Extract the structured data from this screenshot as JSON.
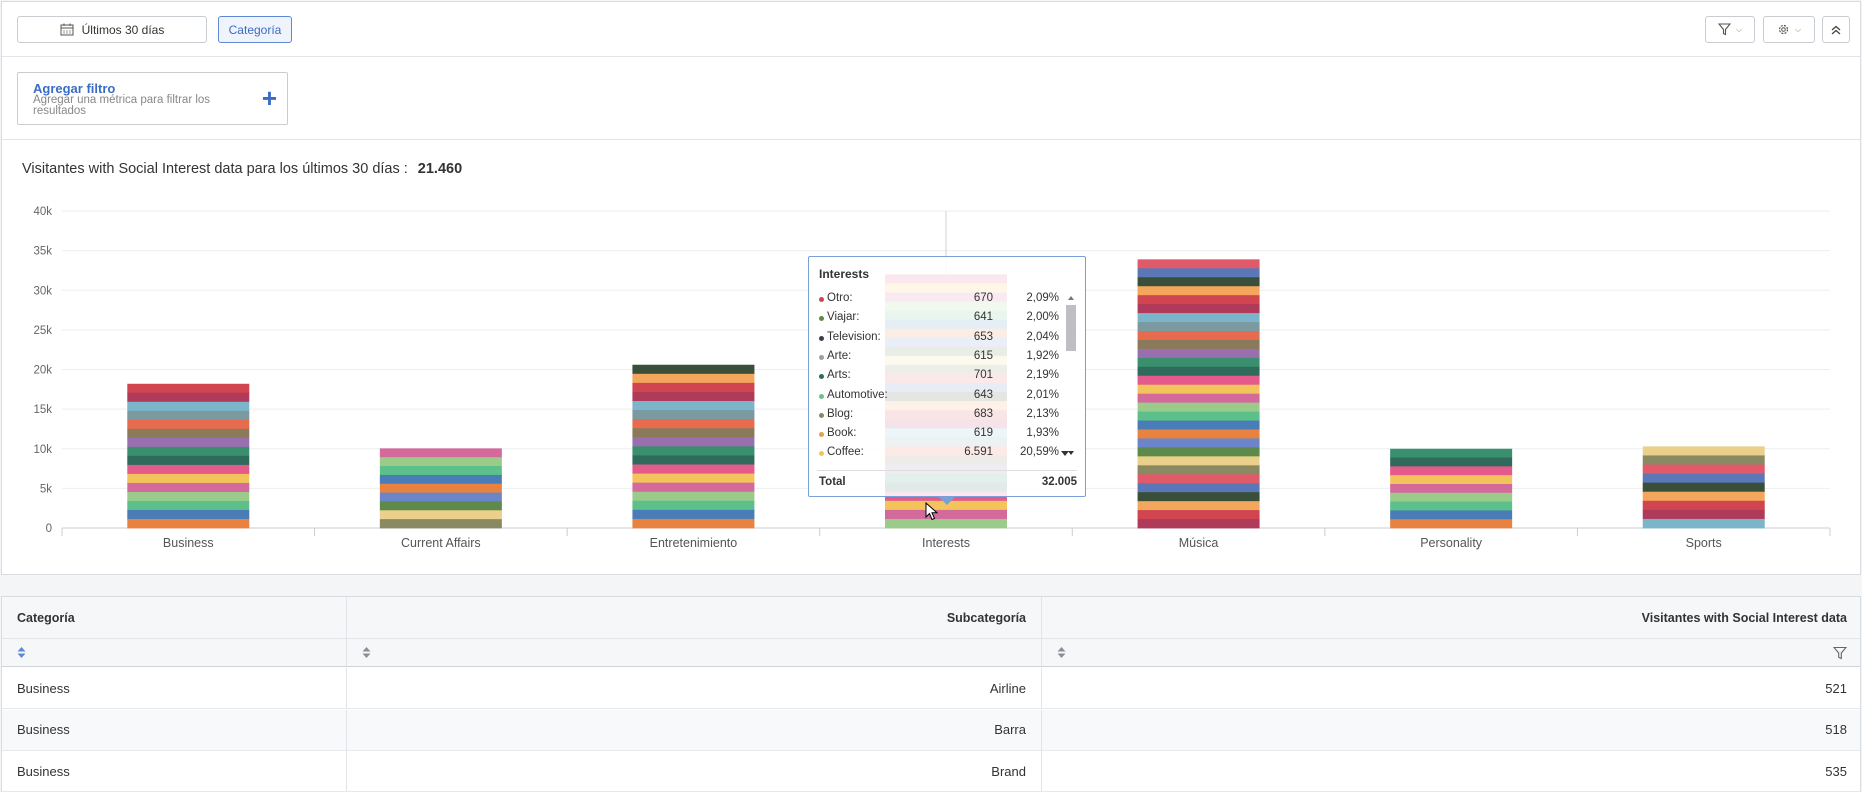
{
  "toolbar": {
    "date_range": "Últimos 30 días",
    "category_button": "Categoría"
  },
  "filter": {
    "add_title": "Agregar filtro",
    "add_desc": "Agregar una métrica para filtrar los resultados"
  },
  "summary": {
    "label": "Visitantes with Social Interest data para los últimos 30 días :",
    "value": "21.460"
  },
  "chart_data": {
    "type": "bar",
    "stacked": true,
    "categories": [
      "Business",
      "Current Affairs",
      "Entretenimiento",
      "Interests",
      "Música",
      "Personality",
      "Sports"
    ],
    "values": [
      18200,
      10050,
      20600,
      32005,
      33900,
      10000,
      10300
    ],
    "ylim": [
      0,
      40000
    ],
    "yticks": [
      "0",
      "5k",
      "10k",
      "15k",
      "20k",
      "25k",
      "30k",
      "35k",
      "40k"
    ],
    "grid": true,
    "legend": "none"
  },
  "tooltip": {
    "title": "Interests",
    "rows": [
      {
        "label": "Otro:",
        "value": "670",
        "pct": "2,09%",
        "color": "#d0454f"
      },
      {
        "label": "Viajar:",
        "value": "641",
        "pct": "2,00%",
        "color": "#5d8a4a"
      },
      {
        "label": "Television:",
        "value": "653",
        "pct": "2,04%",
        "color": "#3a3f4a"
      },
      {
        "label": "Arte:",
        "value": "615",
        "pct": "1,92%",
        "color": "#9aa0a8"
      },
      {
        "label": "Arts:",
        "value": "701",
        "pct": "2,19%",
        "color": "#2e6b5a"
      },
      {
        "label": "Automotive:",
        "value": "643",
        "pct": "2,01%",
        "color": "#6cc08b"
      },
      {
        "label": "Blog:",
        "value": "683",
        "pct": "2,13%",
        "color": "#8a8a62"
      },
      {
        "label": "Book:",
        "value": "619",
        "pct": "1,93%",
        "color": "#e0a24a"
      },
      {
        "label": "Coffee:",
        "value": "6.591",
        "pct": "20,59%",
        "color": "#f3c45c"
      }
    ],
    "total_label": "Total",
    "total_value": "32.005"
  },
  "table": {
    "headers": [
      "Categoría",
      "Subcategoría",
      "Visitantes with Social Interest data"
    ],
    "rows": [
      [
        "Business",
        "Airline",
        "521"
      ],
      [
        "Business",
        "Barra",
        "518"
      ],
      [
        "Business",
        "Brand",
        "535"
      ]
    ]
  }
}
